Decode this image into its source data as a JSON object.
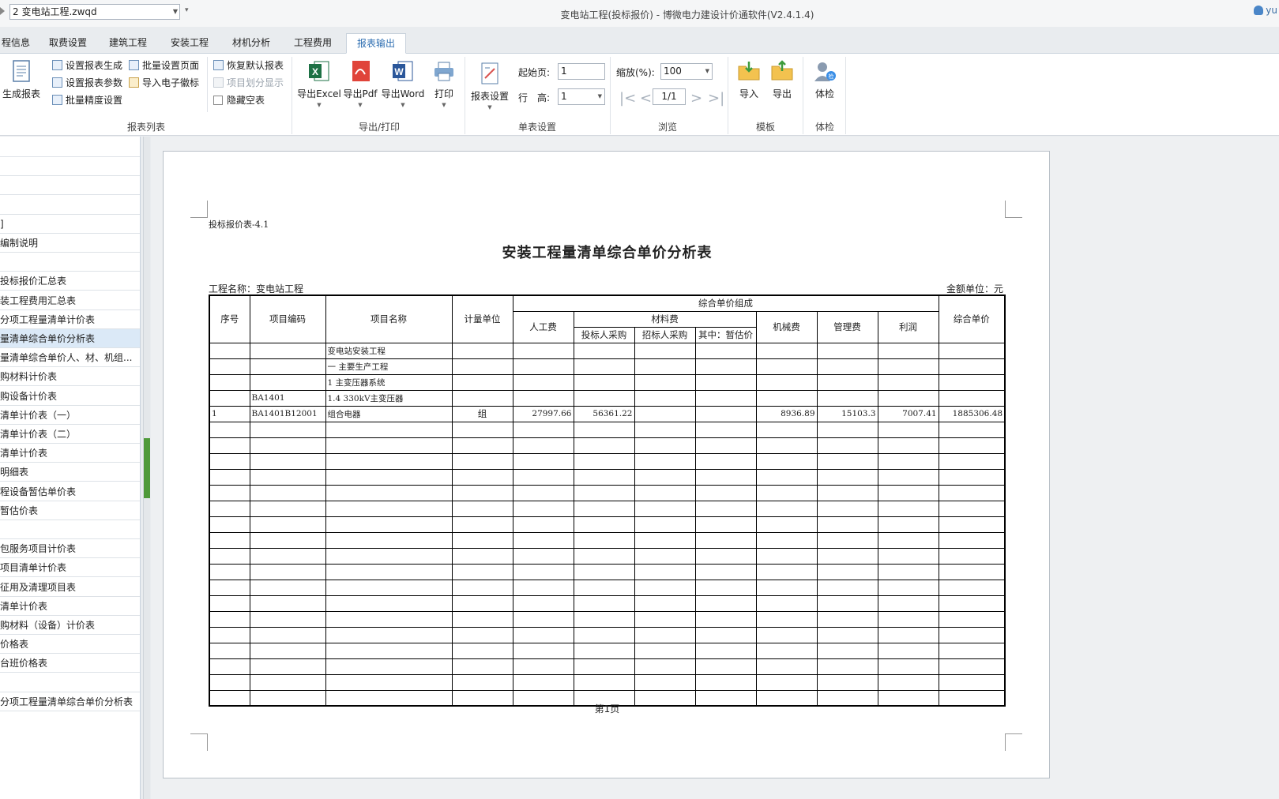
{
  "titlebar": {
    "file_name": "2 变电站工程.zwqd",
    "window_title": "变电站工程(投标报价) - 博微电力建设计价通软件(V2.4.1.4)",
    "user": "yu"
  },
  "tabs": [
    "程信息",
    "取费设置",
    "建筑工程",
    "安装工程",
    "材机分析",
    "工程费用",
    "报表输出"
  ],
  "active_tab": "报表输出",
  "ribbon": {
    "generate_report": "生成报表",
    "small": {
      "set_report_gen": "设置报表生成",
      "set_report_params": "设置报表参数",
      "batch_precision": "批量精度设置",
      "batch_page_setup": "批量设置页面",
      "import_stamp": "导入电子徽标",
      "restore_default": "恢复默认报表",
      "item_division": "项目划分显示",
      "hide_empty": "隐藏空表"
    },
    "group_report_list": "报表列表",
    "export_excel": "导出Excel",
    "export_pdf": "导出Pdf",
    "export_word": "导出Word",
    "print": "打印",
    "group_export_print": "导出/打印",
    "report_settings": "报表设置",
    "start_page_label": "起始页:",
    "start_page_value": "1",
    "row_height_label": "行　高:",
    "row_height_value": "1",
    "group_single": "单表设置",
    "zoom_label": "缩放(%):",
    "zoom_value": "100",
    "page_indicator": "1/1",
    "group_browse": "浏览",
    "import": "导入",
    "export": "导出",
    "group_template": "模板",
    "check": "体检",
    "group_check": "体检"
  },
  "left_list": [
    "",
    "",
    "",
    "",
    "]",
    "编制说明",
    "",
    "投标报价汇总表",
    "装工程费用汇总表",
    "分项工程量清单计价表",
    "量清单综合单价分析表",
    "量清单综合单价人、材、机组...",
    "购材料计价表",
    "购设备计价表",
    "清单计价表（一）",
    "清单计价表（二）",
    "清单计价表",
    "明细表",
    "程设备暂估单价表",
    "暂估价表",
    "",
    "包服务项目计价表",
    "项目清单计价表",
    "征用及清理项目表",
    "清单计价表",
    "购材料（设备）计价表",
    "价格表",
    "台班价格表",
    "",
    "分项工程量清单综合单价分析表"
  ],
  "selected_index": 10,
  "report": {
    "form_no": "投标报价表-4.1",
    "title": "安装工程量清单综合单价分析表",
    "project": "工程名称：变电站工程",
    "unit": "金额单位：元",
    "headers": {
      "seq": "序号",
      "code": "项目编码",
      "name": "项目名称",
      "uom": "计量单位",
      "composition": "综合单价组成",
      "labor": "人工费",
      "material": "材料费",
      "bidder_purchase": "投标人采购",
      "tenderer_purchase": "招标人采购",
      "provisional": "其中：暂估价",
      "machine": "机械费",
      "management": "管理费",
      "profit": "利润",
      "unit_price": "综合单价"
    },
    "rows": [
      [
        "",
        "",
        "变电站安装工程",
        "",
        "",
        "",
        "",
        "",
        "",
        "",
        "",
        ""
      ],
      [
        "",
        "",
        "一 主要生产工程",
        "",
        "",
        "",
        "",
        "",
        "",
        "",
        "",
        ""
      ],
      [
        "",
        "",
        "1 主变压器系统",
        "",
        "",
        "",
        "",
        "",
        "",
        "",
        "",
        ""
      ],
      [
        "",
        "BA1401",
        "1.4 330kV主变压器",
        "",
        "",
        "",
        "",
        "",
        "",
        "",
        "",
        ""
      ],
      [
        "1",
        "BA1401B12001",
        "组合电器",
        "组",
        "27997.66",
        "56361.22",
        "",
        "",
        "8936.89",
        "15103.3",
        "7007.41",
        "1885306.48"
      ]
    ],
    "page_label": "第1页"
  }
}
